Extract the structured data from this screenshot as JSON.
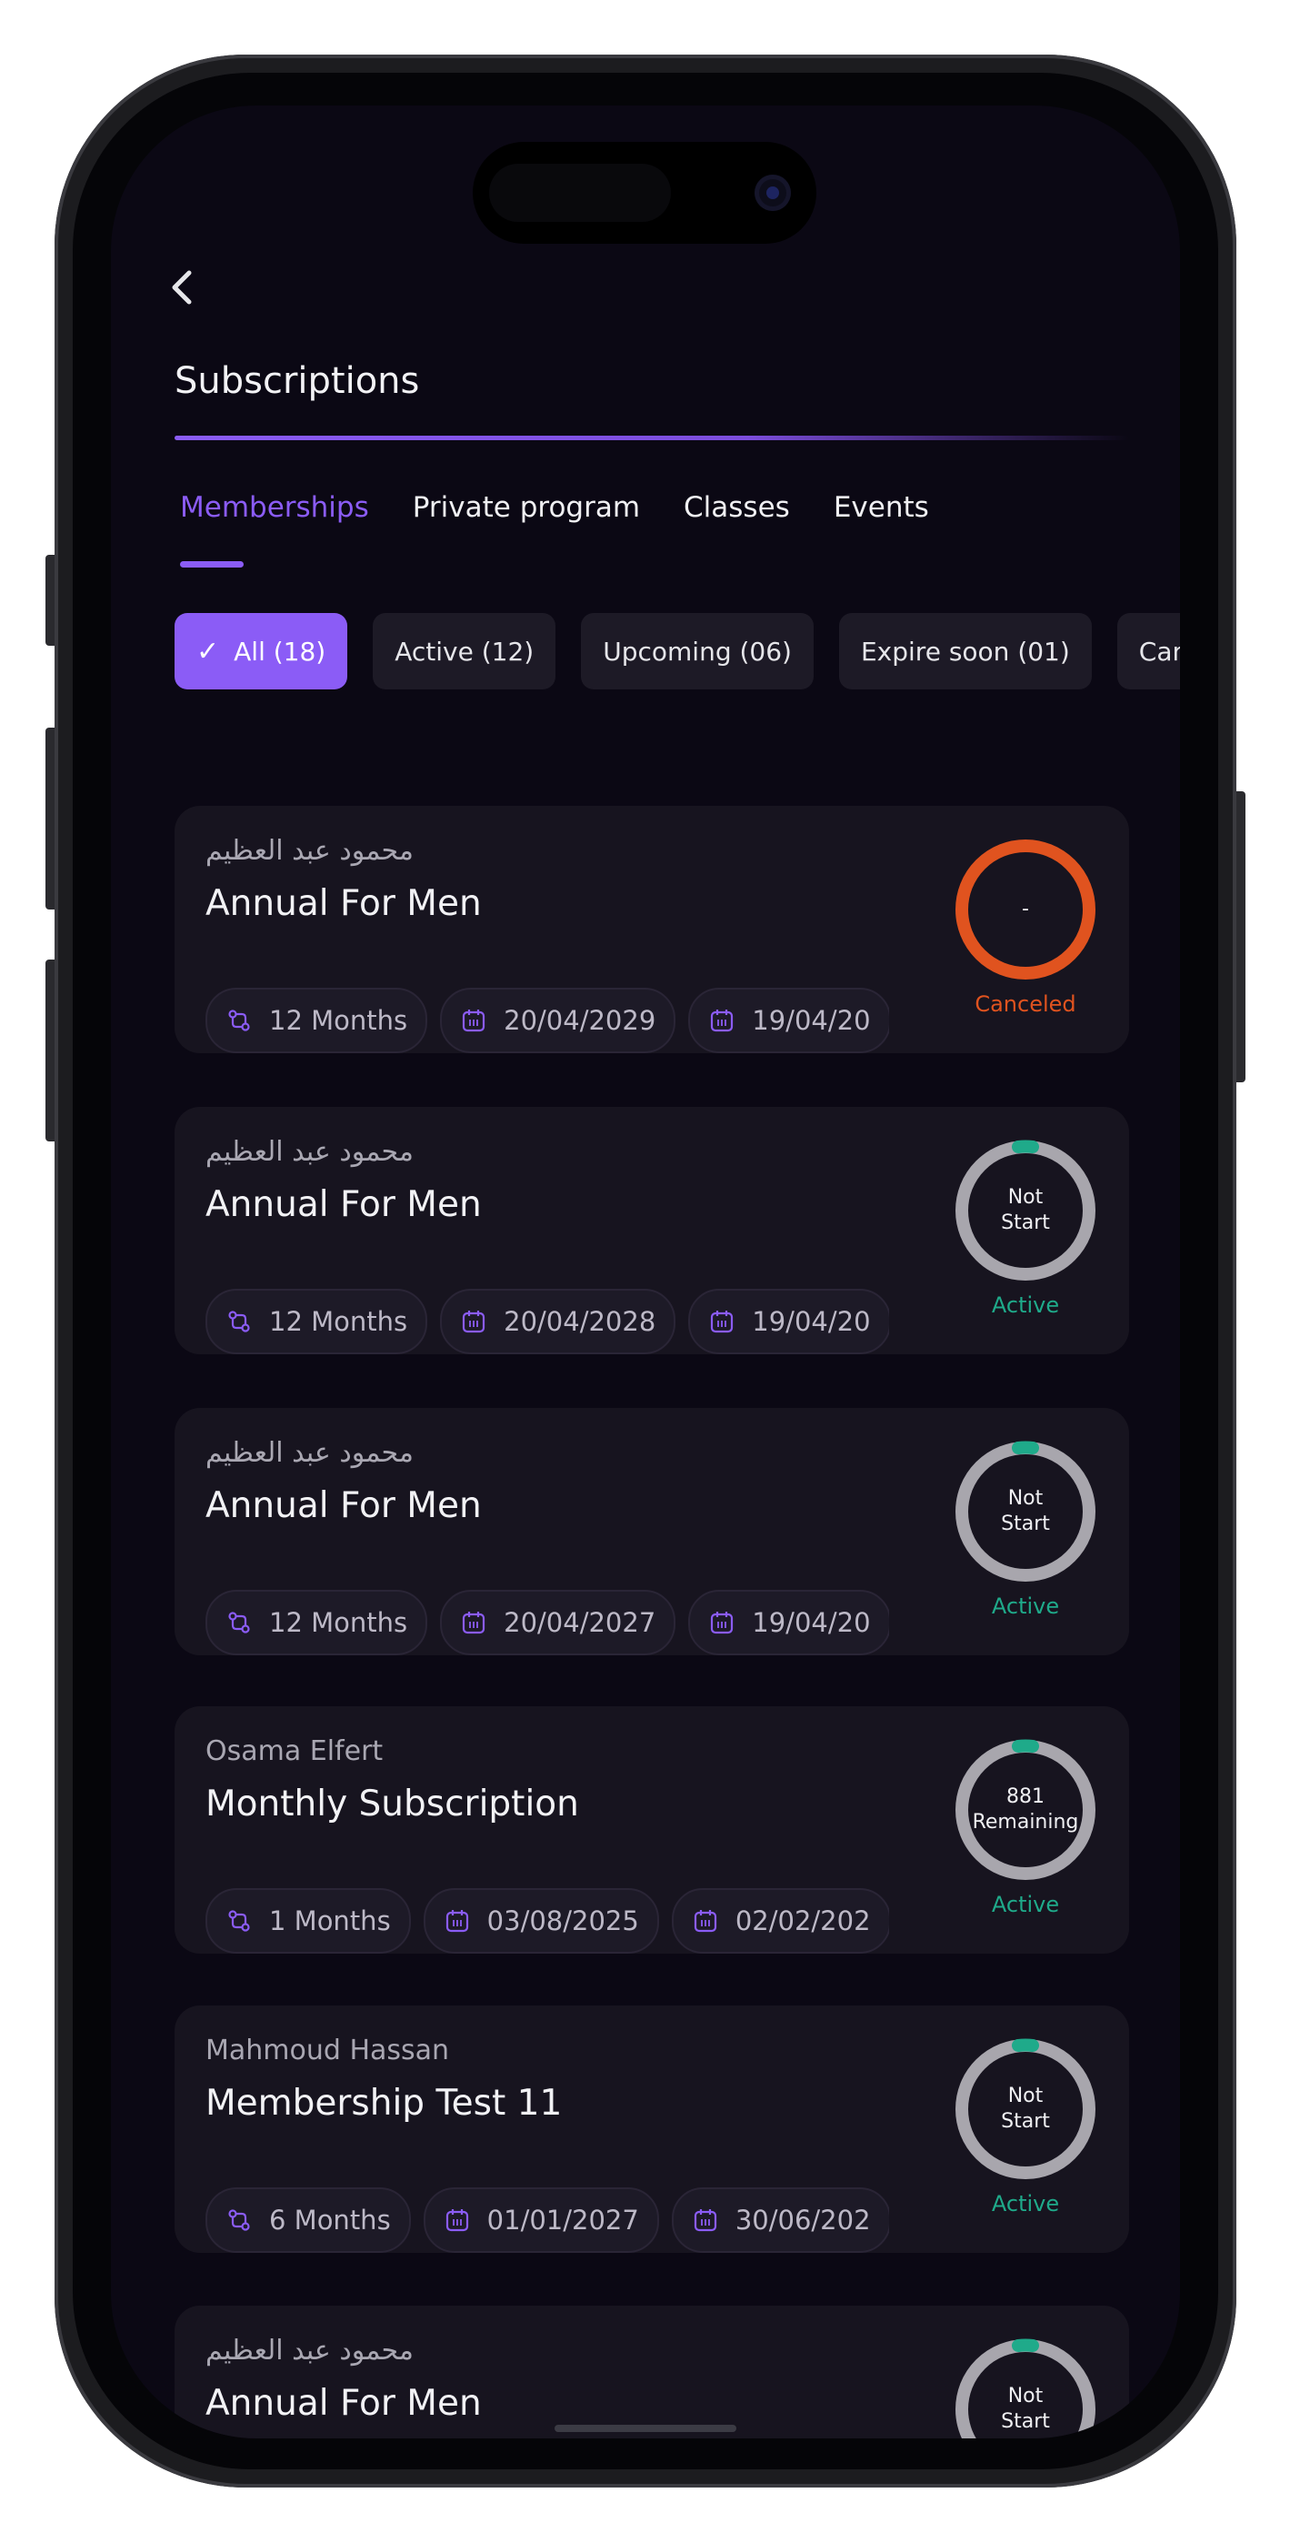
{
  "header": {
    "back_icon": "chevron-left-icon",
    "title": "Subscriptions"
  },
  "tabs": [
    {
      "label": "Memberships",
      "active": true
    },
    {
      "label": "Private program",
      "active": false
    },
    {
      "label": "Classes",
      "active": false
    },
    {
      "label": "Events",
      "active": false
    }
  ],
  "filters": [
    {
      "label": "All (18)",
      "active": true,
      "icon": "check-icon"
    },
    {
      "label": "Active (12)",
      "active": false
    },
    {
      "label": "Upcoming (06)",
      "active": false
    },
    {
      "label": "Expire soon (01)",
      "active": false
    },
    {
      "label": "Cancled",
      "active": false
    }
  ],
  "colors": {
    "accent": "#8b5cf6",
    "canceled": "#e0531f",
    "active_status": "#1faa8a",
    "ring_track": "#a8a6ad"
  },
  "cards": [
    {
      "owner": "محمود عبد العظيم",
      "plan": "Annual For Men",
      "duration": "12 Months",
      "start_date": "20/04/2029",
      "end_date": "19/04/20",
      "ring_label": [
        "-"
      ],
      "status": "Canceled",
      "status_kind": "canceled"
    },
    {
      "owner": "محمود عبد العظيم",
      "plan": "Annual For Men",
      "duration": "12 Months",
      "start_date": "20/04/2028",
      "end_date": "19/04/20",
      "ring_label": [
        "Not",
        "Start"
      ],
      "status": "Active",
      "status_kind": "active"
    },
    {
      "owner": "محمود عبد العظيم",
      "plan": "Annual For Men",
      "duration": "12 Months",
      "start_date": "20/04/2027",
      "end_date": "19/04/20",
      "ring_label": [
        "Not",
        "Start"
      ],
      "status": "Active",
      "status_kind": "active"
    },
    {
      "owner": "Osama Elfert",
      "plan": "Monthly Subscription",
      "duration": "1 Months",
      "start_date": "03/08/2025",
      "end_date": "02/02/202",
      "ring_label": [
        "881",
        "Remaining"
      ],
      "status": "Active",
      "status_kind": "active"
    },
    {
      "owner": "Mahmoud Hassan",
      "plan": "Membership Test 11",
      "duration": "6 Months",
      "start_date": "01/01/2027",
      "end_date": "30/06/202",
      "ring_label": [
        "Not",
        "Start"
      ],
      "status": "Active",
      "status_kind": "active"
    },
    {
      "owner": "محمود عبد العظيم",
      "plan": "Annual For Men",
      "duration": "",
      "start_date": "",
      "end_date": "",
      "ring_label": [
        "Not",
        "Start"
      ],
      "status": "",
      "status_kind": "active"
    }
  ]
}
